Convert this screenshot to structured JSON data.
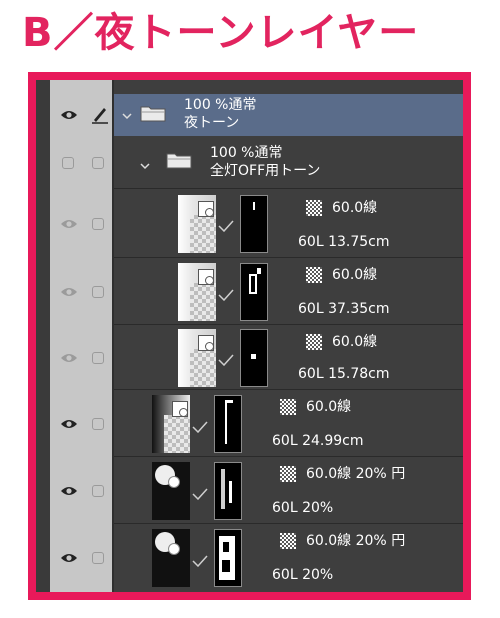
{
  "heading": "B／夜トーンレイヤー",
  "folder_main": {
    "blend": "100 %通常",
    "name": "夜トーン"
  },
  "folder_sub": {
    "blend": "100 %通常",
    "name": "全灯OFF用トーン"
  },
  "layers": [
    {
      "tone": "60.0線",
      "info": "60L 13.75cm"
    },
    {
      "tone": "60.0線",
      "info": "60L 37.35cm"
    },
    {
      "tone": "60.0線",
      "info": "60L 15.78cm"
    },
    {
      "tone": "60.0線",
      "info": "60L 24.99cm"
    },
    {
      "tone": "60.0線 20% 円",
      "info": "60L 20%"
    },
    {
      "tone": "60.0線 20% 円",
      "info": "60L 20%"
    }
  ],
  "colors": {
    "accent": "#e8195a",
    "heading": "#e2245f",
    "panel_bg": "#3e3e3e",
    "selected_row": "#5a6c8a",
    "column_bg": "#c7c7c7"
  },
  "icons": {
    "visibility": "eye-icon",
    "edit": "pen-icon",
    "folder": "folder-icon",
    "expand": "chevron-down-icon",
    "tone": "checker-tone-icon"
  }
}
